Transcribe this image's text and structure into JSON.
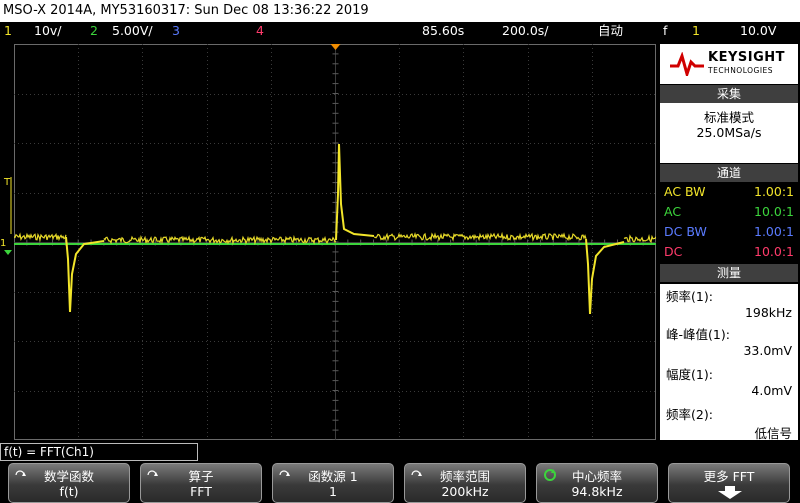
{
  "title": "MSO-X 2014A, MY53160317: Sun Dec 08 13:36:22 2019",
  "status": {
    "ch1_num": "1",
    "ch1_scale": "10v/",
    "ch2_num": "2",
    "ch2_scale": "5.00V/",
    "ch3_num": "3",
    "ch4_num": "4",
    "time_offset": "85.60s",
    "time_scale": "200.0s/",
    "mode": "自动",
    "trig_slope": "f",
    "trig_ch": "1",
    "trig_level": "10.0V"
  },
  "colors": {
    "ch1": "#f2e52a",
    "ch2": "#3cd43c",
    "ch3": "#5a7bff",
    "ch4": "#ff3b6b"
  },
  "brand": {
    "name": "KEYSIGHT",
    "sub": "TECHNOLOGIES"
  },
  "acquisition": {
    "header": "采集",
    "mode": "标准模式",
    "rate": "25.0MSa/s"
  },
  "channels": {
    "header": "通道",
    "rows": [
      {
        "label": "AC BW",
        "value": "1.00:1"
      },
      {
        "label": "AC",
        "value": "10.0:1"
      },
      {
        "label": "DC BW",
        "value": "1.00:1"
      },
      {
        "label": "DC",
        "value": "10.0:1"
      }
    ]
  },
  "measurements": {
    "header": "测量",
    "freq1_label": "频率(1):",
    "freq1_value": "198kHz",
    "pp_label": "峰-峰值(1):",
    "pp_value": "33.0mV",
    "amp_label": "幅度(1):",
    "amp_value": "4.0mV",
    "freq2_label": "频率(2):",
    "freq2_value": "低信号"
  },
  "markers": {
    "trigger_marker": "T",
    "ch1_marker": "1"
  },
  "math": {
    "function_text": "f(t) = FFT(Ch1)"
  },
  "softkeys": [
    {
      "title": "数学函数",
      "value": "f(t)"
    },
    {
      "title": "算子",
      "value": "FFT"
    },
    {
      "title": "函数源 1",
      "value": "1"
    },
    {
      "title": "频率范围",
      "value": "200kHz"
    },
    {
      "title": "中心频率",
      "value": "94.8kHz"
    },
    {
      "title": "更多 FFT",
      "value": ""
    }
  ]
}
